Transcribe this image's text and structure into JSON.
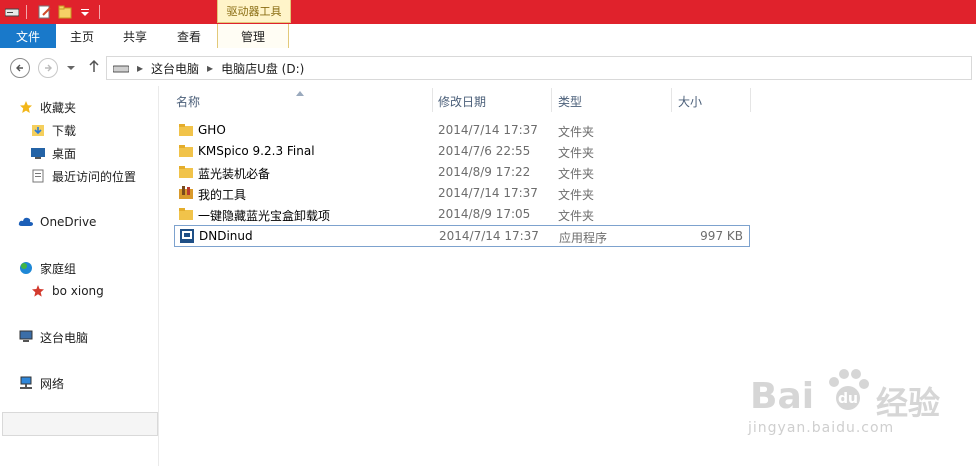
{
  "titlebar": {
    "contextual_tab": "驱动器工具"
  },
  "ribbon": {
    "tabs": {
      "file": "文件",
      "home": "主页",
      "share": "共享",
      "view": "查看",
      "manage": "管理"
    }
  },
  "address": {
    "crumb1": "这台电脑",
    "crumb2": "电脑店U盘 (D:)"
  },
  "sidebar": {
    "favorites": "收藏夹",
    "downloads": "下载",
    "desktop": "桌面",
    "recent": "最近访问的位置",
    "onedrive": "OneDrive",
    "homegroup": "家庭组",
    "user": "bo xiong",
    "thispc": "这台电脑",
    "network": "网络"
  },
  "columns": {
    "name": "名称",
    "date": "修改日期",
    "type": "类型",
    "size": "大小"
  },
  "files": [
    {
      "name": "GHO",
      "date": "2014/7/14 17:37",
      "type": "文件夹",
      "size": ""
    },
    {
      "name": "KMSpico 9.2.3 Final",
      "date": "2014/7/6 22:55",
      "type": "文件夹",
      "size": ""
    },
    {
      "name": "蓝光装机必备",
      "date": "2014/8/9 17:22",
      "type": "文件夹",
      "size": ""
    },
    {
      "name": "我的工具",
      "date": "2014/7/14 17:37",
      "type": "文件夹",
      "size": ""
    },
    {
      "name": "一键隐藏蓝光宝盒卸载项",
      "date": "2014/8/9 17:05",
      "type": "文件夹",
      "size": ""
    },
    {
      "name": "DNDinud",
      "date": "2014/7/14 17:37",
      "type": "应用程序",
      "size": "997 KB"
    }
  ],
  "watermark": {
    "brand": "Bai",
    "brand2": "经验",
    "url": "jingyan.baidu.com"
  }
}
